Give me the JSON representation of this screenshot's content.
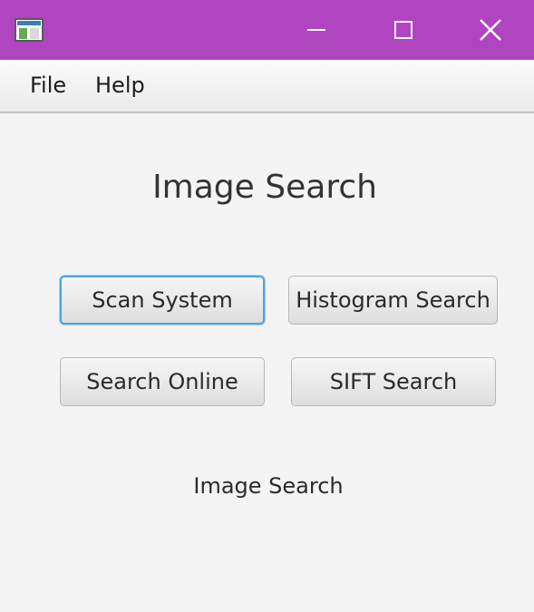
{
  "window": {
    "title_bar_color": "#b045c0",
    "icons": {
      "app": "app-window-icon",
      "minimize": "minimize-icon",
      "maximize": "maximize-icon",
      "close": "close-icon"
    }
  },
  "menu": {
    "file_label": "File",
    "help_label": "Help"
  },
  "main": {
    "heading": "Image Search",
    "buttons": {
      "scan_system": "Scan System",
      "histogram_search": "Histogram Search",
      "search_online": "Search Online",
      "sift_search": "SIFT Search"
    },
    "status_text": "Image Search"
  },
  "colors": {
    "focus_accent": "#4aa4e0",
    "background": "#f4f4f4"
  }
}
